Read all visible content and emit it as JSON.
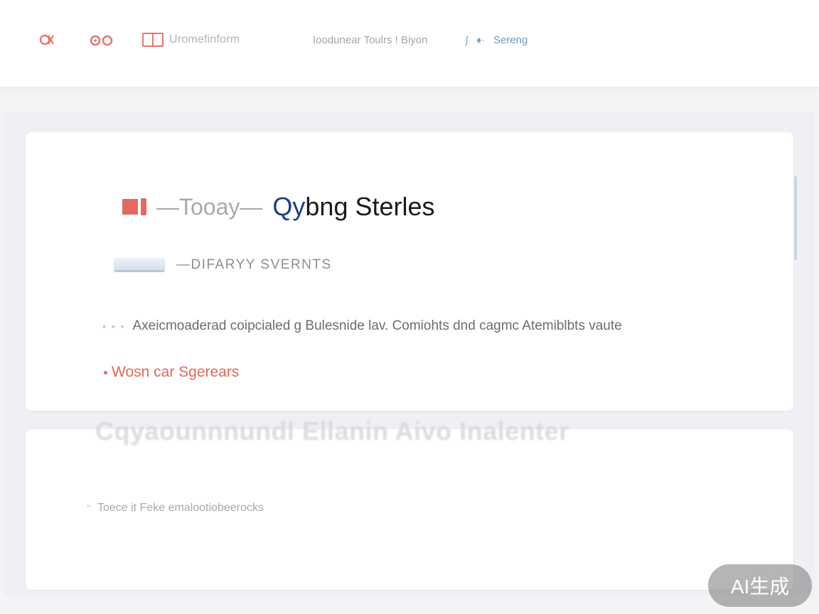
{
  "header": {
    "brand_label": "Uromefinform",
    "nav_middle": "Ioodunear Toulrs ! Biyon",
    "nav_right_label": "Sereng"
  },
  "icons": {
    "left_icon": "link-icon",
    "second_icon": "glasses-icon",
    "brand_icon": "window-icon",
    "right_icon_a": "pin-icon",
    "right_icon_b": "arrow-icon"
  },
  "main_card": {
    "title_prefix": "—Tooay—",
    "title_accent": "Qy",
    "title_main": "bng Sterles",
    "section_label": "—DIFARYY SVERNTS",
    "description": "Axeicmoaderad coipcialed g Bulesnide lav. Comiohts dnd cagmc Atemiblbts vaute",
    "link_text": "Wosn car Sgerears"
  },
  "second_card": {
    "ghost_heading": "Cqyaounnnundl Ellanin Aivo Inalenter",
    "footer_text": "Toece  it Feke emalootiobeerocks"
  },
  "watermark": {
    "text": "AI生成"
  },
  "colors": {
    "accent_red": "#e46a5f",
    "accent_blue": "#1d3c8e",
    "link_blue": "#6e99c8",
    "background": "#eef0f3"
  }
}
